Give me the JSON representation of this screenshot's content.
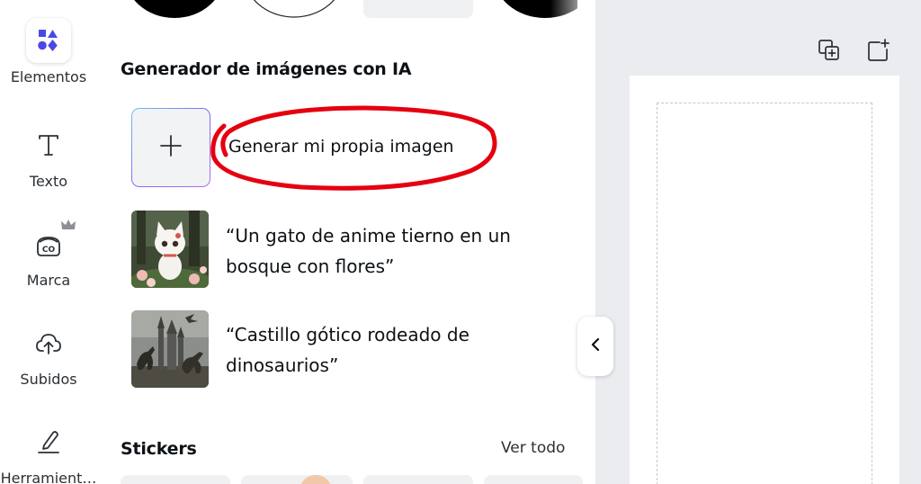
{
  "sidebar": {
    "items": [
      {
        "label": "Elementos",
        "icon": "elements-shapes-icon",
        "active": true
      },
      {
        "label": "Texto",
        "icon": "text-t-icon"
      },
      {
        "label": "Marca",
        "icon": "brand-co-icon",
        "badge_icon": "crown-icon"
      },
      {
        "label": "Subidos",
        "icon": "cloud-upload-icon"
      },
      {
        "label": "Herramient…",
        "icon": "draw-pen-icon"
      }
    ]
  },
  "panel": {
    "ai_section": {
      "title": "Generador de imágenes con IA",
      "generate_label": "Generar mi propia imagen",
      "generate_icon": "plus-icon",
      "suggestions": [
        {
          "line1": "“Un gato de anime tierno en un",
          "line2": "bosque con flores”",
          "image": "anime-cat-forest-image"
        },
        {
          "line1": "“Castillo gótico rodeado de",
          "line2": "dinosaurios”",
          "image": "gothic-castle-dinosaurs-image"
        }
      ]
    },
    "stickers_section": {
      "title": "Stickers",
      "see_all": "Ver todo"
    }
  },
  "canvas": {
    "tools": [
      {
        "icon": "duplicate-page-icon"
      },
      {
        "icon": "add-page-icon"
      }
    ]
  },
  "colors": {
    "accent": "#7d2ae8",
    "annotation_red": "#e5000f",
    "canvas_bg": "#ebecf0"
  }
}
